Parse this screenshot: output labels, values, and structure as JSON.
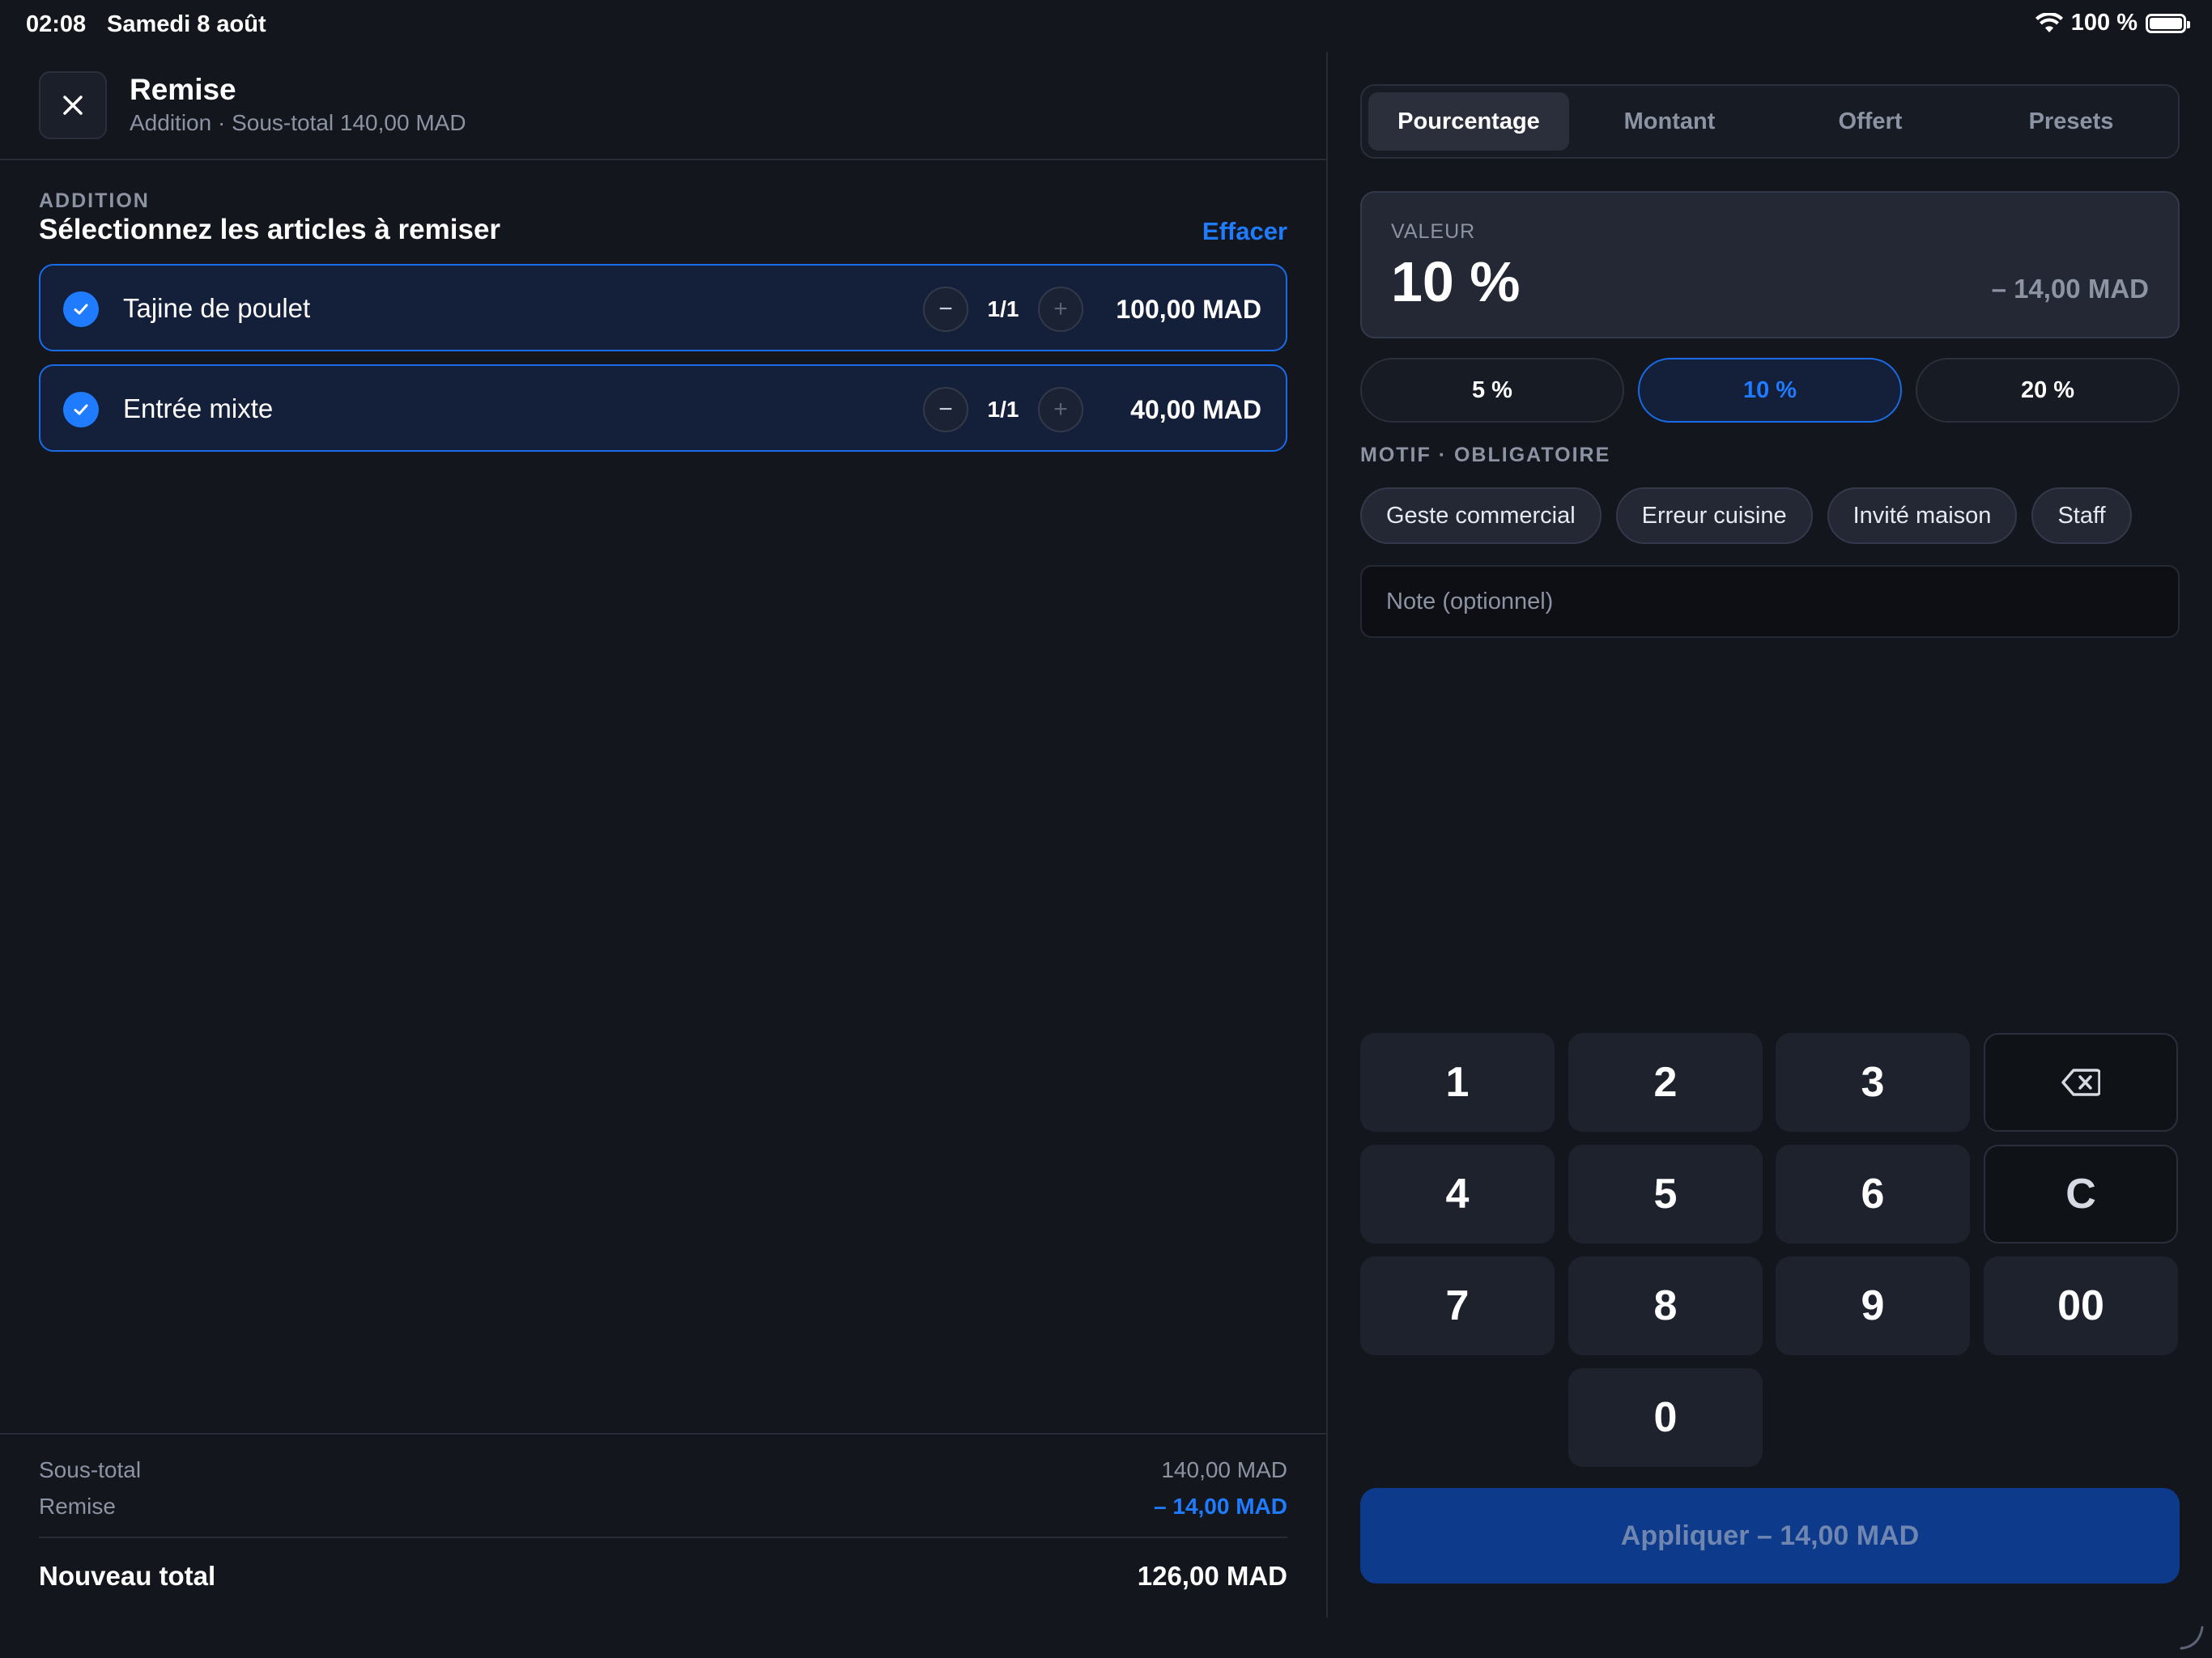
{
  "status_bar": {
    "time": "02:08",
    "date": "Samedi 8 août",
    "battery": "100 %"
  },
  "header": {
    "title": "Remise",
    "subtitle": "Addition · Sous-total 140,00 MAD"
  },
  "items_section": {
    "label": "ADDITION",
    "title": "Sélectionnez les articles à remiser",
    "clear_label": "Effacer",
    "items": [
      {
        "name": "Tajine de poulet",
        "qty": "1/1",
        "price": "100,00 MAD",
        "selected": true
      },
      {
        "name": "Entrée mixte",
        "qty": "1/1",
        "price": "40,00 MAD",
        "selected": true
      }
    ]
  },
  "totals": {
    "subtotal_label": "Sous-total",
    "subtotal_value": "140,00 MAD",
    "discount_label": "Remise",
    "discount_value": "– 14,00 MAD",
    "total_label": "Nouveau total",
    "total_value": "126,00 MAD"
  },
  "tabs": [
    {
      "label": "Pourcentage",
      "active": true
    },
    {
      "label": "Montant",
      "active": false
    },
    {
      "label": "Offert",
      "active": false
    },
    {
      "label": "Presets",
      "active": false
    }
  ],
  "value": {
    "label": "VALEUR",
    "display": "10 %",
    "amount": "– 14,00 MAD"
  },
  "presets": [
    {
      "label": "5 %",
      "active": false
    },
    {
      "label": "10 %",
      "active": true
    },
    {
      "label": "20 %",
      "active": false
    }
  ],
  "motif": {
    "label": "MOTIF · OBLIGATOIRE",
    "chips": [
      "Geste commercial",
      "Erreur cuisine",
      "Invité maison",
      "Staff"
    ]
  },
  "note": {
    "placeholder": "Note (optionnel)",
    "value": ""
  },
  "keypad": {
    "keys": [
      "1",
      "2",
      "3",
      "4",
      "5",
      "6",
      "7",
      "8",
      "9",
      "00",
      "0"
    ],
    "clear": "C",
    "backspace_icon": "backspace-icon"
  },
  "apply_button": "Appliquer – 14,00 MAD",
  "colors": {
    "accent": "#1f7bff",
    "background": "#13161d",
    "selected_item_bg": "#14203a",
    "apply_bg": "#0d3a8a"
  }
}
